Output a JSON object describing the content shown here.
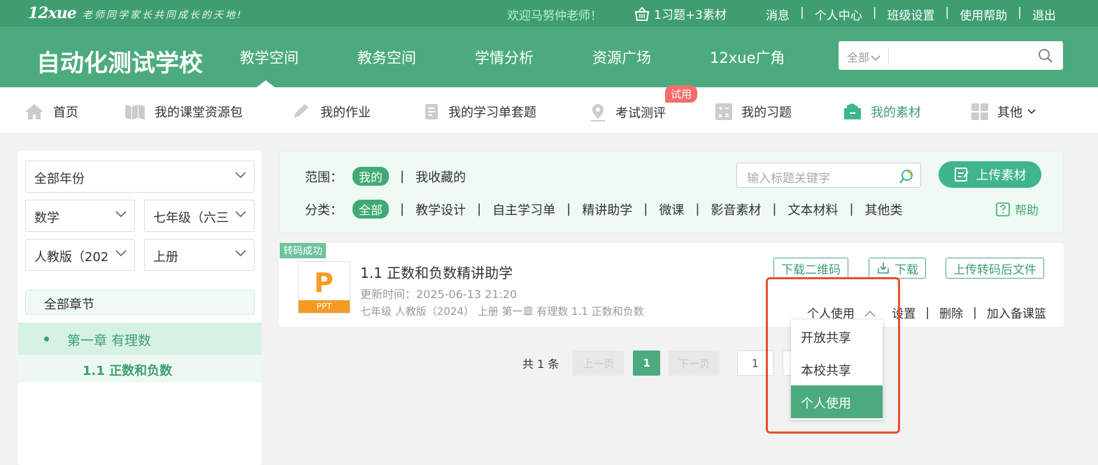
{
  "topbar": {
    "logo": "12xue",
    "slogan": "老师同学家长共同成长的天地!",
    "welcome": "欢迎马努仲老师！",
    "cart": "1习题+3素材",
    "links": [
      "消息",
      "个人中心",
      "班级设置",
      "使用帮助",
      "退出"
    ]
  },
  "header": {
    "school": "自动化测试学校",
    "nav": [
      "教学空间",
      "教务空间",
      "学情分析",
      "资源广场",
      "12xue广角"
    ],
    "search_scope": "全部"
  },
  "subnav": {
    "items": [
      "首页",
      "我的课堂资源包",
      "我的作业",
      "我的学习单套题",
      "考试测评",
      "我的习题",
      "我的素材",
      "其他"
    ],
    "badge": "试用"
  },
  "left": {
    "year": "全部年份",
    "subject": "数学",
    "grade": "七年级（六三",
    "edition": "人教版（202",
    "volume": "上册",
    "all_chapters": "全部章节",
    "chapter": "第一章 有理数",
    "section": "1.1 正数和负数"
  },
  "filter": {
    "scope_label": "范围：",
    "scope": [
      "我的",
      "我收藏的"
    ],
    "category_label": "分类：",
    "categories": [
      "全部",
      "教学设计",
      "自主学习单",
      "精讲助学",
      "微课",
      "影音素材",
      "文本材料",
      "其他类"
    ],
    "search_placeholder": "输入标题关键字",
    "upload": "上传素材",
    "help": "帮助"
  },
  "card": {
    "tag": "转码成功",
    "file_type": "PPT",
    "title": "1.1 正数和负数精讲助学",
    "updated": "更新时间：2025-06-13 21:20",
    "path": "七年级 人教版（2024） 上册 第一章 有理数 1.1 正数和负数",
    "buttons": [
      "下载二维码",
      "下载",
      "上传转码后文件"
    ],
    "visibility": "个人使用",
    "actions": [
      "设置",
      "删除",
      "加入备课篮"
    ]
  },
  "pager": {
    "total": "共 1 条",
    "prev": "上一页",
    "current": "1",
    "next": "下一页",
    "goto": "1"
  },
  "dropdown": {
    "options": [
      "开放共享",
      "本校共享",
      "个人使用"
    ],
    "selected": "个人使用"
  },
  "colors": {
    "primary": "#4cab7e",
    "dark": "#3f9e70",
    "highlight_box": "#e5502d"
  }
}
